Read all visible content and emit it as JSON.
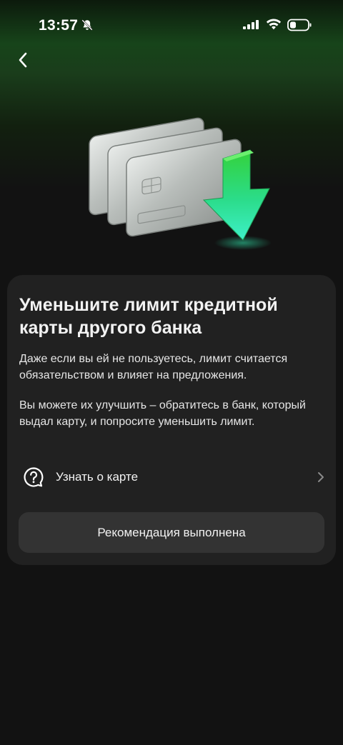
{
  "status_bar": {
    "time": "13:57",
    "icons": [
      "bell-off-icon",
      "signal-icon",
      "wifi-icon",
      "battery-icon"
    ]
  },
  "header": {
    "back_icon": "chevron-left-icon"
  },
  "hero": {
    "image": "credit-cards-with-down-arrow"
  },
  "card": {
    "title": "Уменьшите лимит кредитной карты другого банка",
    "paragraph1": "Даже если вы ей не пользуетесь, лимит считается обязательством и влияет на предложения.",
    "paragraph2": "Вы можете их улучшить – обратитесь в банк, который выдал карту, и попросите уменьшить лимит.",
    "info_row": {
      "label": "Узнать о карте",
      "icon": "question-bubble-icon",
      "chevron": "chevron-right-icon"
    },
    "button_label": "Рекомендация выполнена"
  },
  "colors": {
    "background": "#121212",
    "card": "#212121",
    "button": "#333333",
    "accent_green": "#21c24a",
    "arrow_teal": "#2fe0a8"
  }
}
